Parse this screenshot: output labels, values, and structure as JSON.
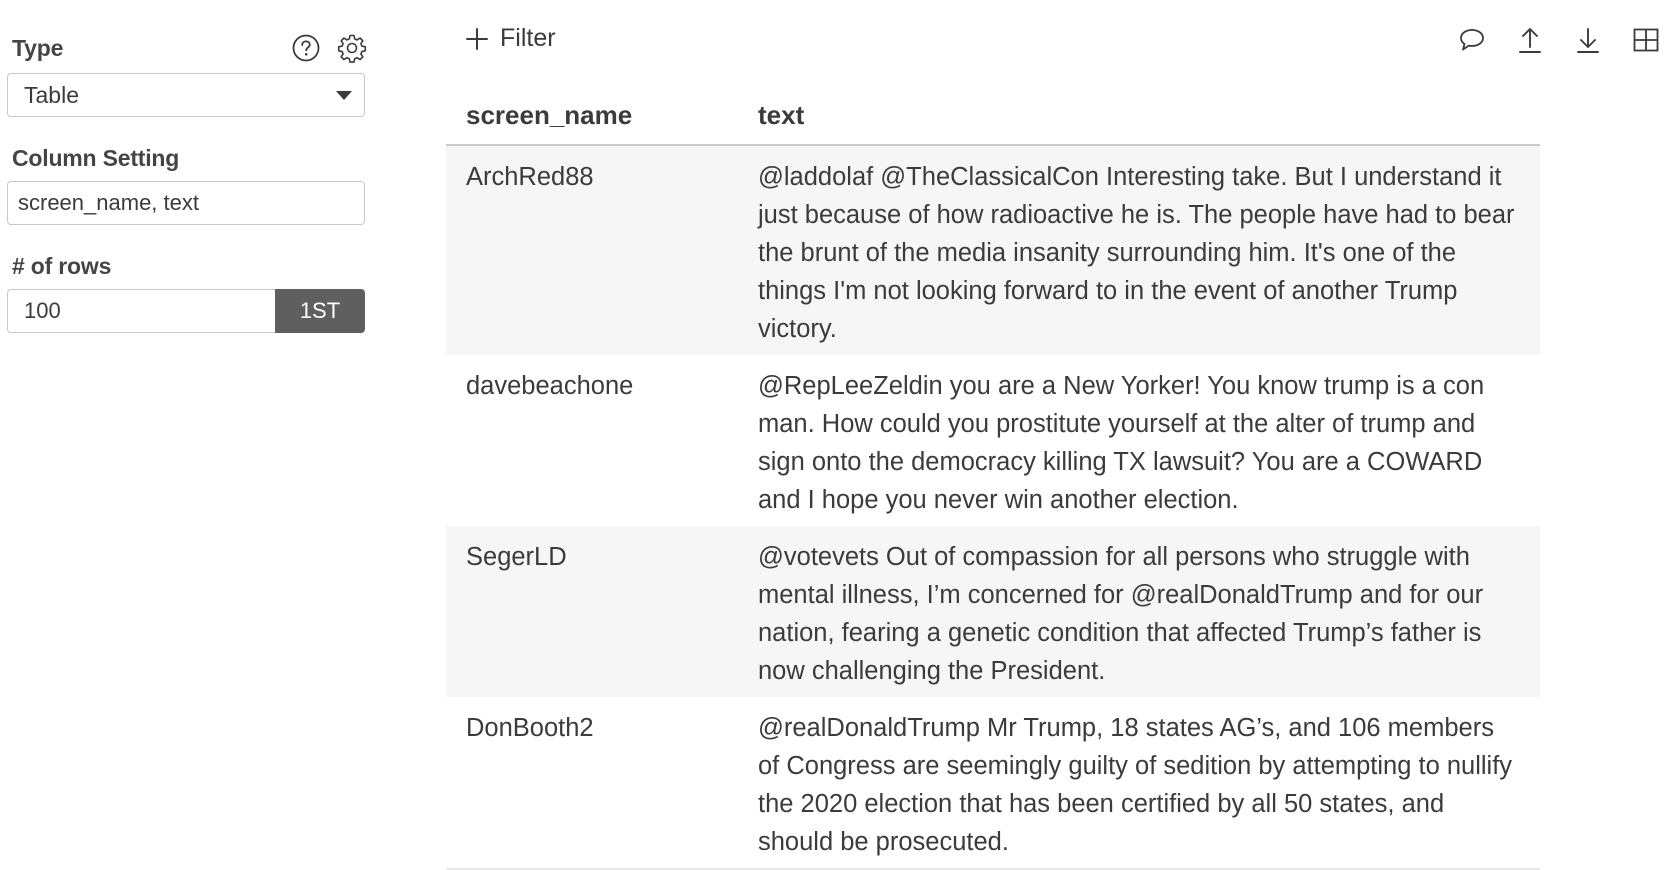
{
  "sidebar": {
    "type_label": "Type",
    "type_value": "Table",
    "column_setting_label": "Column Setting",
    "column_setting_value": "screen_name, text",
    "rows_label": "# of rows",
    "rows_value": "100",
    "rows_button": "1ST"
  },
  "toolbar": {
    "filter_label": "Filter"
  },
  "table": {
    "headers": [
      "screen_name",
      "text"
    ],
    "rows": [
      {
        "screen_name": "ArchRed88",
        "text": "@laddolaf @TheClassicalCon Interesting take. But I understand it just because of how radioactive he is. The people have had to bear the brunt of the media insanity surrounding him. It's one of the things I'm not looking forward to in the event of another Trump victory."
      },
      {
        "screen_name": "davebeachone",
        "text": "@RepLeeZeldin you are a New Yorker! You know trump is a con man. How could you prostitute yourself at the alter of trump and sign onto the democracy killing TX lawsuit? You are a COWARD and I hope you never win another election."
      },
      {
        "screen_name": "SegerLD",
        "text": "@votevets Out of compassion for all persons who struggle with mental illness, I’m concerned for @realDonaldTrump and for our nation, fearing a genetic condition that affected Trump’s father is now challenging the President."
      },
      {
        "screen_name": "DonBooth2",
        "text": "@realDonaldTrump Mr Trump, 18 states AG’s, and 106 members of Congress are seemingly guilty of sedition by attempting to nullify the 2020 election that has been certified by all 50 states, and should be prosecuted."
      }
    ]
  },
  "icons": {
    "help": "help-circle-icon",
    "settings": "gear-icon",
    "filter": "plus-icon",
    "comment": "comment-icon",
    "upload": "upload-icon",
    "download": "download-icon",
    "grid": "grid-icon"
  },
  "colors": {
    "button_bg": "#5f5f5f",
    "row_stripe": "#f6f6f6",
    "text": "#3b3b3b"
  }
}
